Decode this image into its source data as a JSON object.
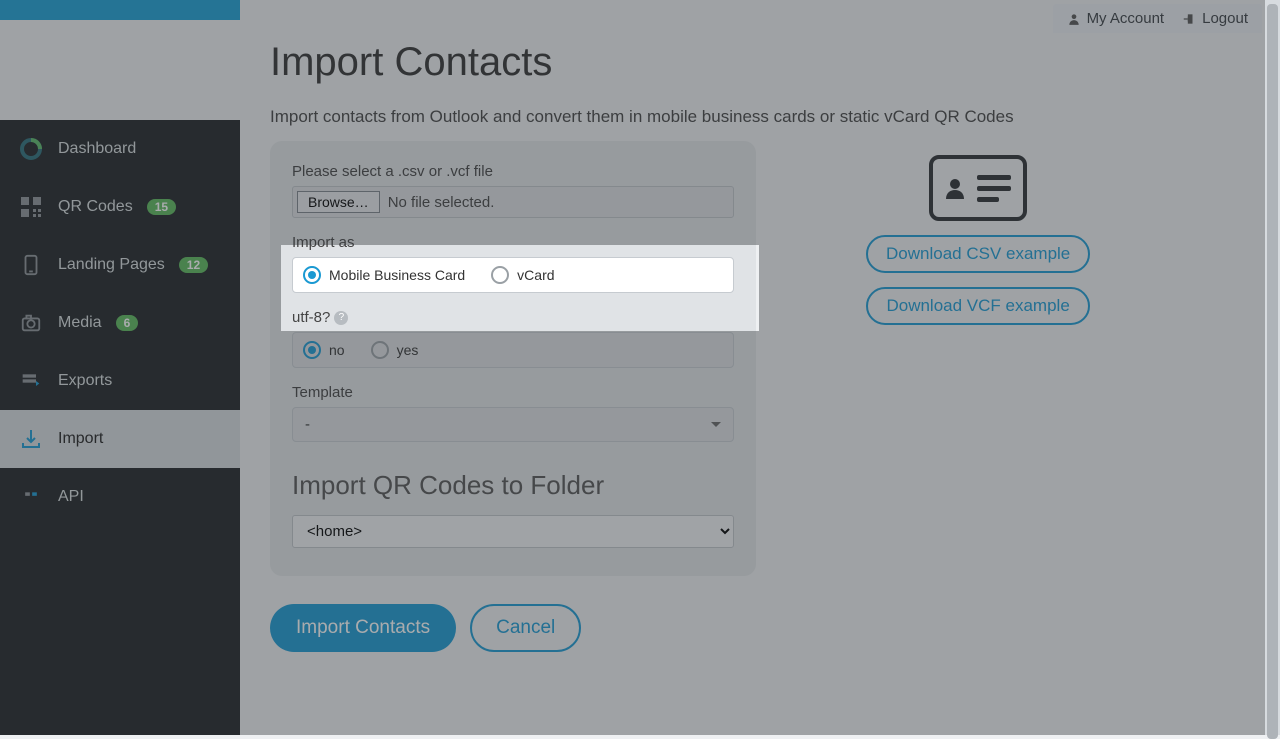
{
  "topbar": {
    "my_account": "My Account",
    "logout": "Logout"
  },
  "sidebar": {
    "items": [
      {
        "label": "Dashboard",
        "badge": null
      },
      {
        "label": "QR Codes",
        "badge": "15"
      },
      {
        "label": "Landing Pages",
        "badge": "12"
      },
      {
        "label": "Media",
        "badge": "6"
      },
      {
        "label": "Exports",
        "badge": null
      },
      {
        "label": "Import",
        "badge": null,
        "active": true
      },
      {
        "label": "API",
        "badge": null
      }
    ]
  },
  "page": {
    "title": "Import Contacts",
    "subtitle": "Import contacts from Outlook and convert them in mobile business cards or static vCard QR Codes",
    "form": {
      "file_label": "Please select a .csv or .vcf file",
      "browse": "Browse…",
      "file_status": "No file selected.",
      "import_as_label": "Import as",
      "import_as_options": [
        "Mobile Business Card",
        "vCard"
      ],
      "import_as_selected": "Mobile Business Card",
      "utf8_label": "utf-8?",
      "utf8_options": [
        "no",
        "yes"
      ],
      "utf8_selected": "no",
      "template_label": "Template",
      "template_value": "-",
      "folder_title": "Import QR Codes to Folder",
      "folder_value": "<home>"
    },
    "actions": {
      "primary": "Import Contacts",
      "secondary": "Cancel"
    },
    "downloads": {
      "csv": "Download CSV example",
      "vcf": "Download VCF example"
    }
  }
}
